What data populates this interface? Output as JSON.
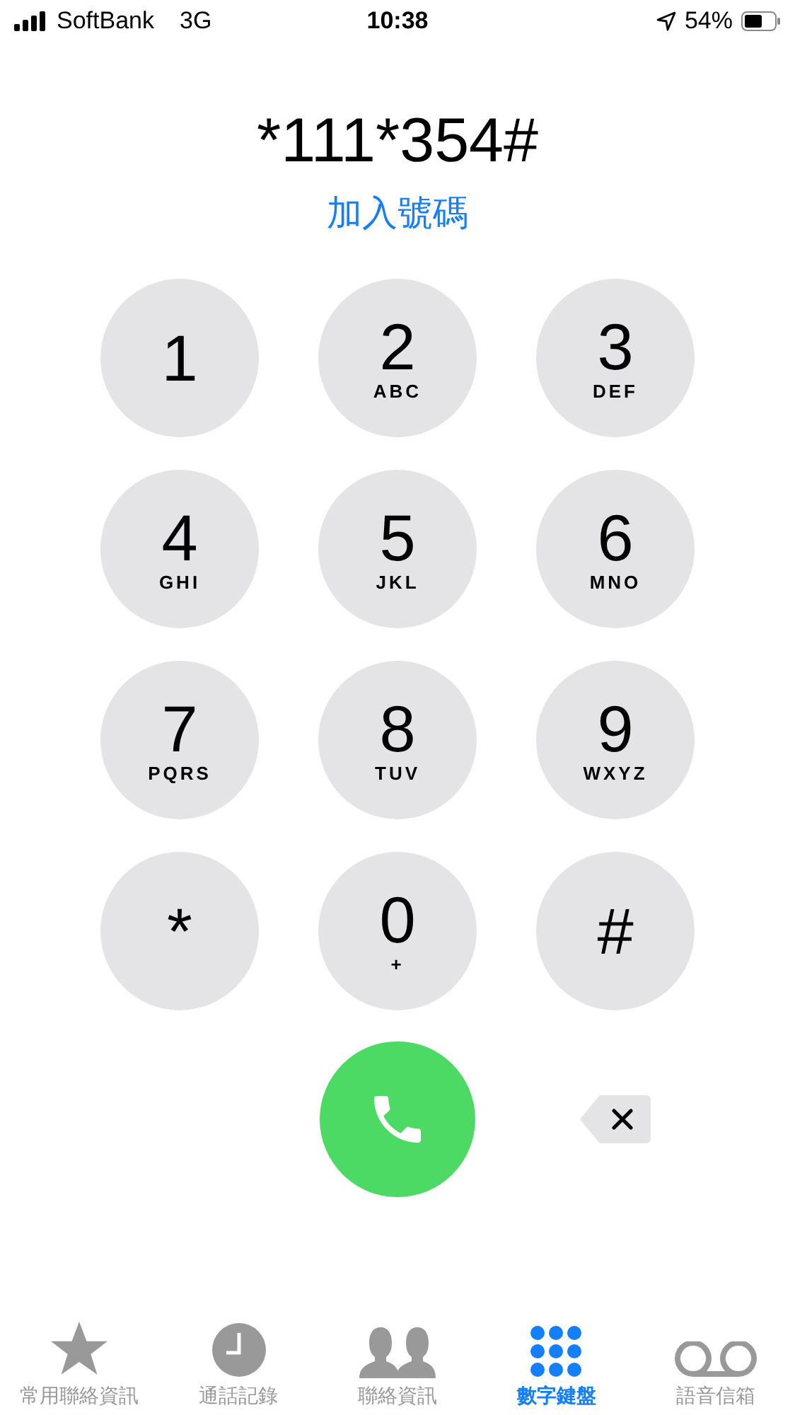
{
  "status_bar": {
    "carrier": "SoftBank",
    "network": "3G",
    "time": "10:38",
    "battery": "54%"
  },
  "dialed_number": "*111*354#",
  "add_number_link": "加入號碼",
  "keys": [
    {
      "digit": "1"
    },
    {
      "digit": "2",
      "letters": "ABC"
    },
    {
      "digit": "3",
      "letters": "DEF"
    },
    {
      "digit": "4",
      "letters": "GHI"
    },
    {
      "digit": "5",
      "letters": "JKL"
    },
    {
      "digit": "6",
      "letters": "MNO"
    },
    {
      "digit": "7",
      "letters": "PQRS"
    },
    {
      "digit": "8",
      "letters": "TUV"
    },
    {
      "digit": "9",
      "letters": "WXYZ"
    },
    {
      "digit": "*"
    },
    {
      "digit": "0",
      "letters": "+"
    },
    {
      "digit": "#"
    }
  ],
  "tabs": [
    {
      "kind": "favorites",
      "label": "常用聯絡資訊",
      "selected": false
    },
    {
      "kind": "recents",
      "label": "通話記錄",
      "selected": false
    },
    {
      "kind": "contacts",
      "label": "聯絡資訊",
      "selected": false
    },
    {
      "kind": "keypad",
      "label": "數字鍵盤",
      "selected": true
    },
    {
      "kind": "voicemail",
      "label": "語音信箱",
      "selected": false
    }
  ]
}
